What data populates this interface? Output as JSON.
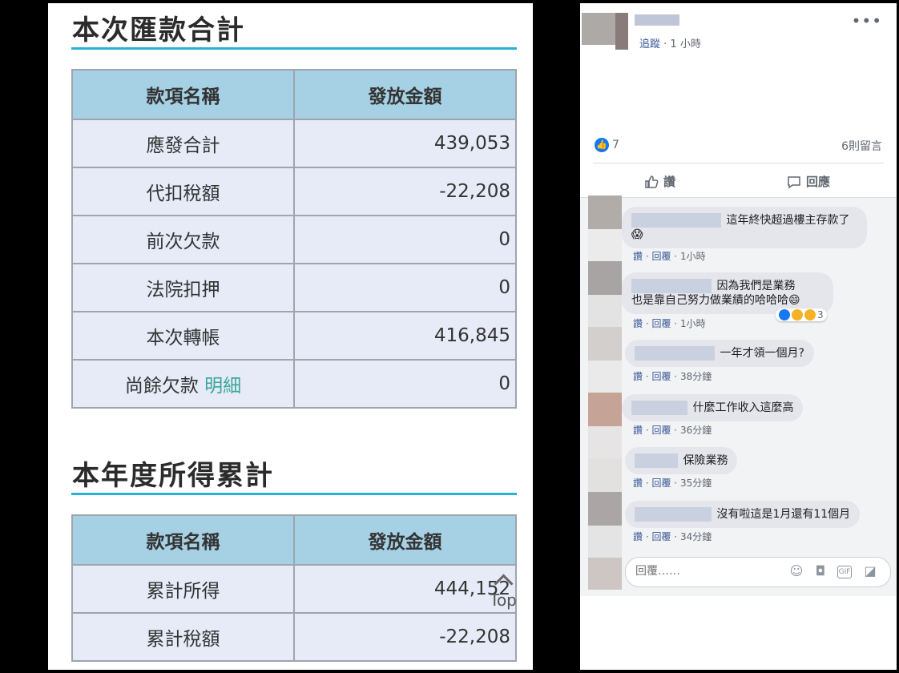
{
  "left": {
    "section1": {
      "title": "本次匯款合計",
      "headers": [
        "款項名稱",
        "發放金額"
      ],
      "rows": [
        {
          "name": "應發合計",
          "amount": "439,053"
        },
        {
          "name": "代扣稅額",
          "amount": "-22,208"
        },
        {
          "name": "前次欠款",
          "amount": "0"
        },
        {
          "name": "法院扣押",
          "amount": "0"
        },
        {
          "name": "本次轉帳",
          "amount": "416,845"
        },
        {
          "name": "尚餘欠款",
          "link": "明細",
          "amount": "0"
        }
      ]
    },
    "section2": {
      "title": "本年度所得累計",
      "headers": [
        "款項名稱",
        "發放金額"
      ],
      "rows": [
        {
          "name": "累計所得",
          "amount": "444,152"
        },
        {
          "name": "累計稅額",
          "amount": "-22,208"
        }
      ]
    },
    "top_button": "Top"
  },
  "right": {
    "post": {
      "follow": "追蹤",
      "sep": " · ",
      "time": "1 小時",
      "more": "•••"
    },
    "stats": {
      "likes": "7",
      "comments": "6則留言"
    },
    "actions": {
      "like": "讚",
      "comment": "回應"
    },
    "comments": [
      {
        "text1": "這年終快超過樓主存款了",
        "emoji": "😱",
        "time": "1小時"
      },
      {
        "text1": "因為我們是業務",
        "text2": "也是靠自己努力做業績的哈哈哈😄",
        "time": "1小時",
        "reactions": "3"
      },
      {
        "text1": "一年才領一個月?",
        "time": "38分鐘"
      },
      {
        "text1": "什麼工作收入這麼高",
        "time": "36分鐘"
      },
      {
        "text1": "保險業務",
        "time": "35分鐘"
      },
      {
        "text1": "沒有啦這是1月還有11個月",
        "time": "34分鐘"
      }
    ],
    "comment_actions": {
      "like": "讚",
      "reply": "回覆",
      "dot": " · "
    },
    "reply": {
      "placeholder": "回覆……"
    },
    "colors": {
      "accent": "#1877f2",
      "link": "#385898",
      "rule": "#28b2d6"
    }
  }
}
